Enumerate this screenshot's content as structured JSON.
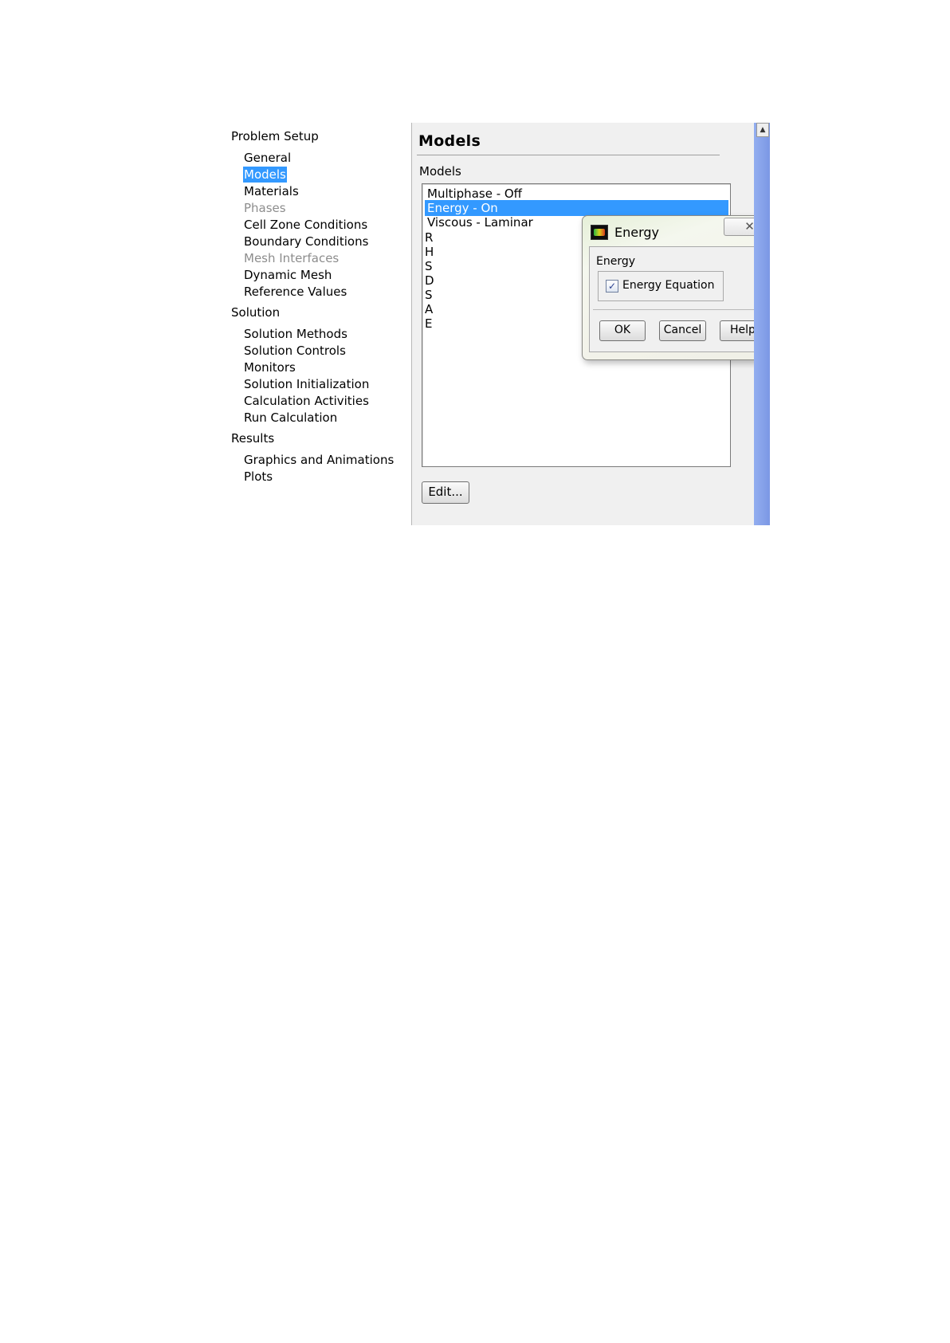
{
  "nav": {
    "problem_setup": {
      "heading": "Problem Setup",
      "items": [
        {
          "label": "General"
        },
        {
          "label": "Models"
        },
        {
          "label": "Materials"
        },
        {
          "label": "Phases"
        },
        {
          "label": "Cell Zone Conditions"
        },
        {
          "label": "Boundary Conditions"
        },
        {
          "label": "Mesh Interfaces"
        },
        {
          "label": "Dynamic Mesh"
        },
        {
          "label": "Reference Values"
        }
      ]
    },
    "solution": {
      "heading": "Solution",
      "items": [
        {
          "label": "Solution Methods"
        },
        {
          "label": "Solution Controls"
        },
        {
          "label": "Monitors"
        },
        {
          "label": "Solution Initialization"
        },
        {
          "label": "Calculation Activities"
        },
        {
          "label": "Run Calculation"
        }
      ]
    },
    "results": {
      "heading": "Results",
      "items": [
        {
          "label": "Graphics and Animations"
        },
        {
          "label": "Plots"
        }
      ]
    },
    "selected": "Models",
    "disabled": [
      "Phases",
      "Mesh Interfaces"
    ]
  },
  "panel": {
    "title": "Models",
    "list_label": "Models",
    "list": [
      {
        "label": "Multiphase - Off"
      },
      {
        "label": "Energy - On"
      },
      {
        "label": "Viscous - Laminar"
      }
    ],
    "list_selected": "Energy - On",
    "hidden_list_initials": [
      "R",
      "H",
      "S",
      "D",
      "S",
      "A",
      "E"
    ],
    "edit_label": "Edit..."
  },
  "dialog": {
    "title": "Energy",
    "close_glyph": "✕",
    "group_label": "Energy",
    "checkbox_label": "Energy Equation",
    "checkbox_checked": true,
    "ok_label": "OK",
    "cancel_label": "Cancel",
    "help_label": "Help"
  },
  "colors": {
    "selection": "#3399ff",
    "panel_bg": "#f0f0f0",
    "scroll_strip": "#7b97e4"
  }
}
